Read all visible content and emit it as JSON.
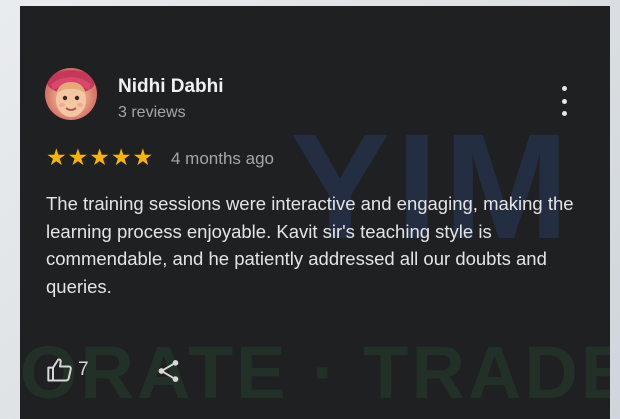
{
  "review": {
    "reviewer_name": "Nidhi Dabhi",
    "review_count": "3 reviews",
    "rating": 5,
    "stars": [
      "★",
      "★",
      "★",
      "★",
      "★"
    ],
    "time_ago": "4 months ago",
    "text": "The training sessions were interactive and engaging, making the learning process enjoyable. Kavit sir's teaching style is commendable, and he patiently addressed all our doubts and queries.",
    "like_count": "7"
  },
  "watermark": {
    "top": "YIM",
    "bottom": "ORATE · TRADE"
  },
  "icons": {
    "more": "more-vert-icon",
    "like": "thumbs-up-icon",
    "share": "share-icon"
  },
  "colors": {
    "card_background": "#1f2022",
    "star": "#f7b500",
    "primary_text": "#e4e4e4",
    "secondary_text": "#a6a6a6"
  }
}
